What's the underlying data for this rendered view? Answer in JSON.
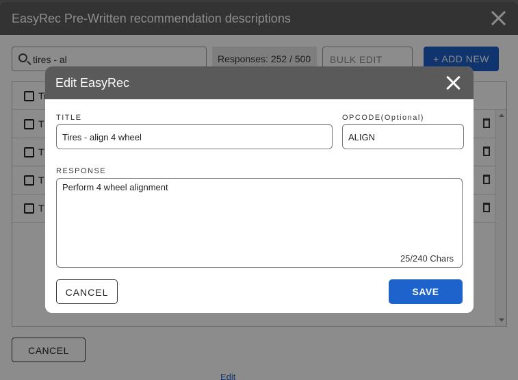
{
  "outer": {
    "title": "EasyRec Pre-Written recommendation descriptions",
    "search_value": "tires - al",
    "responses_count": "Responses: 252  / 500",
    "bulk_edit_label": "BULK EDIT",
    "add_new_label": "+ ADD NEW",
    "table_header_cell": "Ti",
    "rows": [
      "T",
      "T",
      "T",
      "T"
    ],
    "cancel_label": "CANCEL",
    "peek_text": "Edit"
  },
  "modal": {
    "title": "Edit EasyRec",
    "title_label": "TITLE",
    "title_value": "Tires - align 4 wheel",
    "opcode_label": "OPCODE(Optional)",
    "opcode_value": "ALIGN",
    "response_label": "RESPONSE",
    "response_value": "Perform 4 wheel alignment",
    "char_count": "25/240 Chars",
    "cancel_label": "CANCEL",
    "save_label": "SAVE"
  },
  "colors": {
    "header_gray": "#5e5e5e",
    "primary_blue": "#1e63cc"
  },
  "icons": [
    "search-icon",
    "close-icon",
    "checkbox-icon",
    "trash-icon",
    "scroll-up-icon",
    "scroll-down-icon"
  ]
}
